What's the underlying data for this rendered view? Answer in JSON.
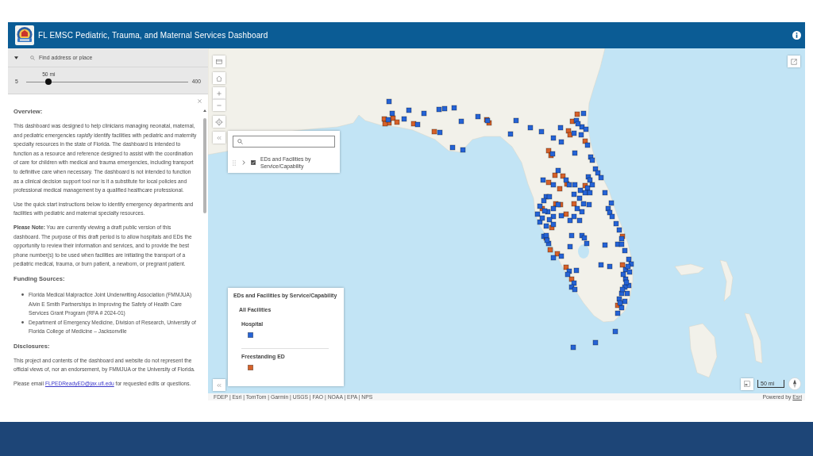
{
  "header": {
    "title": "FL EMSC Pediatric, Trauma, and Maternal Services Dashboard"
  },
  "search": {
    "placeholder": "Find address or place"
  },
  "distance": {
    "value_label": "50 mi",
    "min_label": "5",
    "max_label": "400",
    "level": 0.14
  },
  "overview": {
    "heading": "Overview:",
    "paragraphs": [
      "This dashboard was designed to help clinicians managing neonatal, maternal, and pediatric emergencies *rapidly* identify facilities with pediatric and maternity specialty resources in the state of Florida. The dashboard is intended to function as a resource and reference designed to assist with the coordination of care for children with medical and trauma emergencies, including transport to definitive care when necessary. The dashboard is not intended to function as a clinical decision support tool nor is it a substitute for local policies and professional medical management by a qualified healthcare professional.",
      "Use the quick start instructions below to identify emergency departments and facilities with pediatric and maternal specialty resources.",
      "**Please Note:** You are currently viewing a draft public version of this dashboard. The purpose of this draft period is to allow hospitals and EDs the opportunity to review their information and services, and to provide the best phone number(s) to be used when facilities are initiating the transport of a pediatric medical, trauma, or burn patient, a newborn, or pregnant patient."
    ]
  },
  "funding": {
    "heading": "Funding Sources:",
    "items": [
      "Florida Medical Malpractice Joint Underwriting Association (FMMJUA) Alvin E Smith Partnerships in Improving the Safety of Health Care Services Grant Program (RFA # 2024-01)",
      "Department of Emergency Medicine, Division of Research, University of Florida College of Medicine – Jacksonville"
    ]
  },
  "disclosures": {
    "heading": "Disclosures:",
    "paragraphs": [
      "This project and contents of the dashboard and website do not represent the official views of, nor an endorsement, by FMMJUA or the University of Florida."
    ],
    "contact": {
      "before": "Please email",
      "link": "FLPEDReadyED@jax.ufl.edu",
      "after": "for requested edits or questions."
    }
  },
  "layer_list": {
    "layers": [
      {
        "label": "EDs and Facilities by Service/Capability",
        "visible": true,
        "expanded": false
      }
    ]
  },
  "legend": {
    "title": "EDs and Facilities by Service/Capability",
    "group": "All Facilities",
    "items": [
      {
        "label": "Hospital",
        "color": "#2563d6"
      },
      {
        "label": "Freestanding ED",
        "color": "#d6612a"
      }
    ]
  },
  "map": {
    "scale": "50 mi",
    "attribution": "FDEP | Esri | TomTom | Garmin | USGS | FAO | NOAA | EPA | NPS",
    "powered_by": {
      "text": "Powered by",
      "link": "Esri"
    }
  }
}
